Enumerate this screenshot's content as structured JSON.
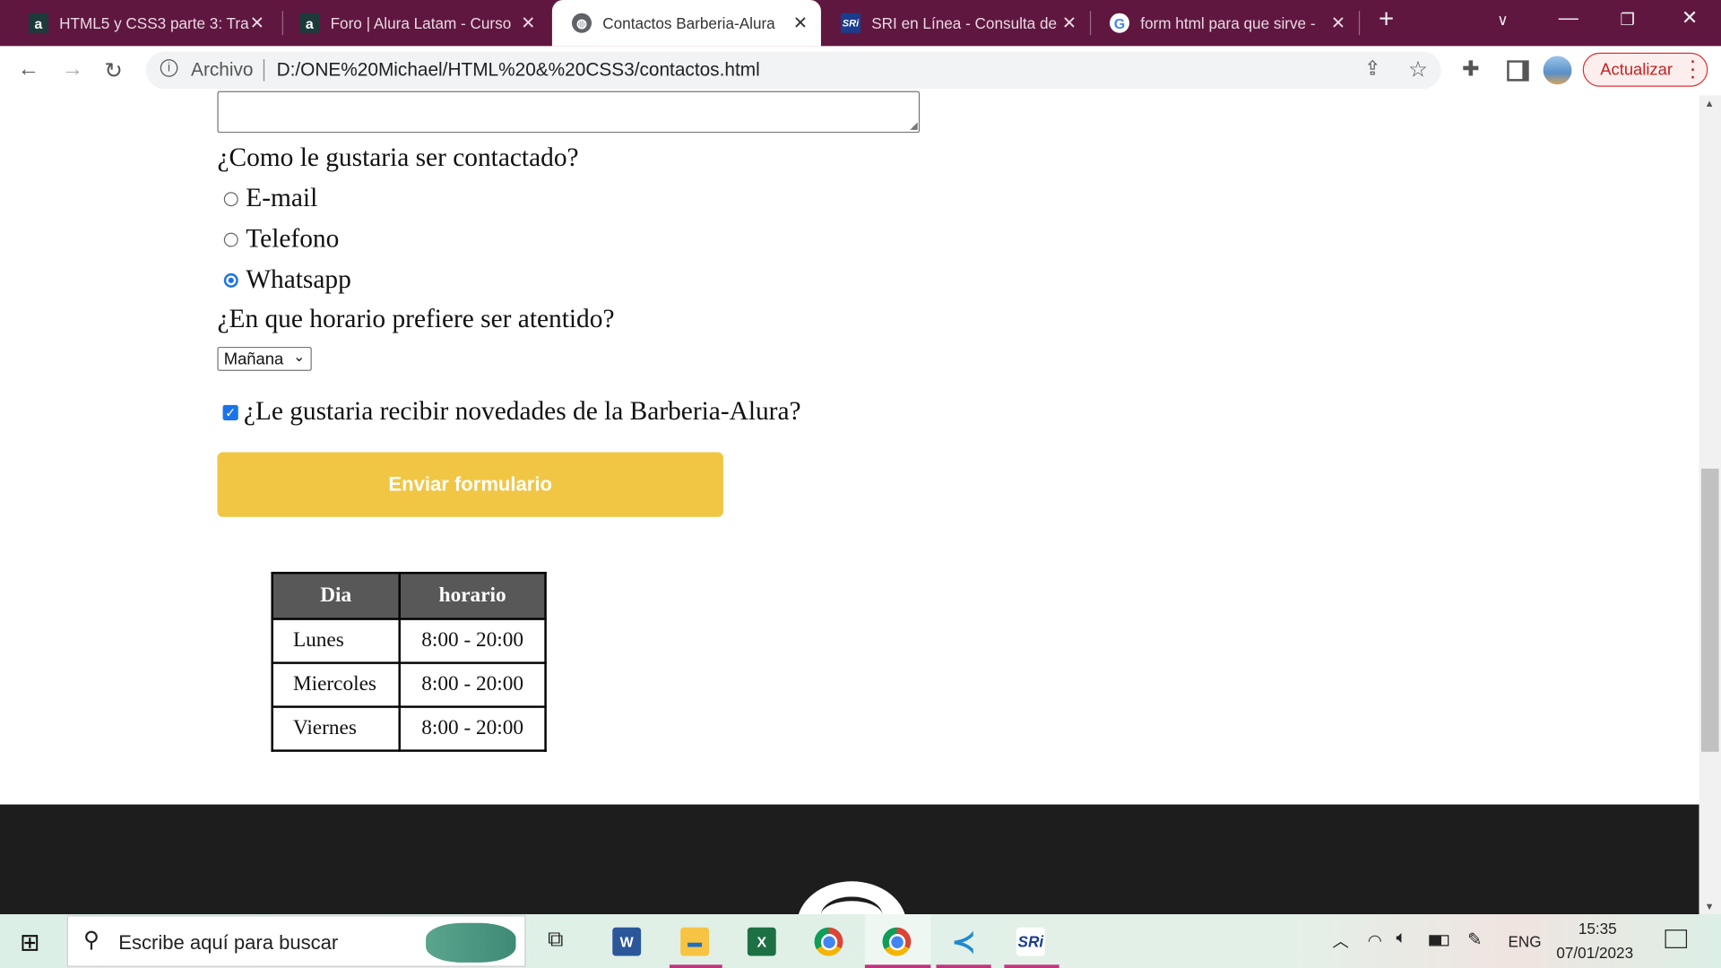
{
  "browser": {
    "tabs": [
      {
        "label": "HTML5 y CSS3 parte 3: Tra",
        "icon": "alura-icon",
        "active": false
      },
      {
        "label": "Foro | Alura Latam - Curso",
        "icon": "alura-icon",
        "active": false
      },
      {
        "label": "Contactos Barberia-Alura",
        "icon": "globe-icon",
        "active": true
      },
      {
        "label": "SRI en Línea - Consulta de",
        "icon": "sri-icon",
        "active": false
      },
      {
        "label": "form html para que sirve -",
        "icon": "google-icon",
        "active": false
      }
    ],
    "address_prefix": "Archivo",
    "url": "D:/ONE%20Michael/HTML%20&%20CSS3/contactos.html",
    "update_button": "Actualizar",
    "accent": "#5f1740"
  },
  "form": {
    "contact_question": "¿Como le gustaria ser contactado?",
    "contact_options": [
      {
        "label": "E-mail",
        "checked": false
      },
      {
        "label": "Telefono",
        "checked": false
      },
      {
        "label": "Whatsapp",
        "checked": true
      }
    ],
    "schedule_question": "¿En que horario prefiere ser atentido?",
    "schedule_selected": "Mañana",
    "newsletter_label": "¿Le gustaria recibir novedades de la Barberia-Alura?",
    "newsletter_checked": true,
    "submit_label": "Enviar formulario",
    "submit_color": "#f1c644"
  },
  "table": {
    "headers": [
      "Dia",
      "horario"
    ],
    "rows": [
      [
        "Lunes",
        "8:00 - 20:00"
      ],
      [
        "Miercoles",
        "8:00 - 20:00"
      ],
      [
        "Viernes",
        "8:00 - 20:00"
      ]
    ]
  },
  "taskbar": {
    "search_placeholder": "Escribe aquí para buscar",
    "language": "ENG",
    "time": "15:35",
    "date": "07/01/2023",
    "sri_label": "SRi"
  }
}
